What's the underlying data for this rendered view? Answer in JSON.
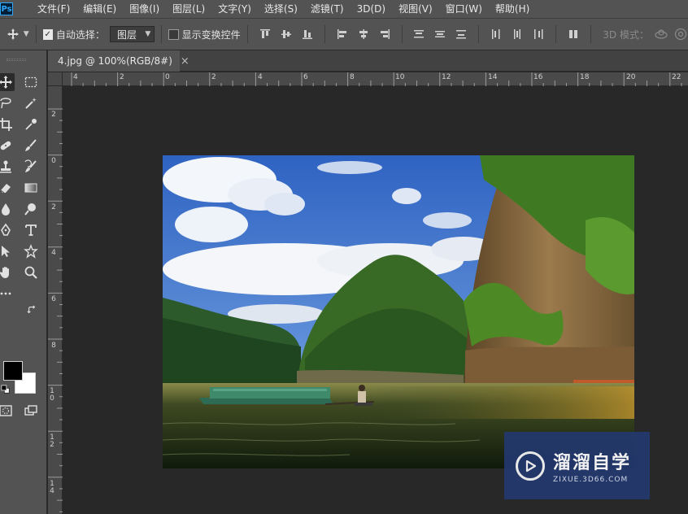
{
  "menubar": {
    "logo": "Ps",
    "items": [
      "文件(F)",
      "编辑(E)",
      "图像(I)",
      "图层(L)",
      "文字(Y)",
      "选择(S)",
      "滤镜(T)",
      "3D(D)",
      "视图(V)",
      "窗口(W)",
      "帮助(H)"
    ]
  },
  "options": {
    "auto_select_label": "自动选择：",
    "auto_select_checked": true,
    "layer_select_value": "图层",
    "show_transform_label": "显示变换控件",
    "mode_3d_label": "3D 模式："
  },
  "document": {
    "tab_title": "4.jpg @ 100%(RGB/8#)",
    "close_glyph": "×"
  },
  "rulers": {
    "h_labels": [
      "4",
      "2",
      "0",
      "2",
      "4",
      "6",
      "8",
      "10",
      "12",
      "14",
      "16",
      "18",
      "20",
      "22"
    ],
    "v_labels": [
      "2",
      "0",
      "2",
      "4",
      "6",
      "8",
      "10",
      "12",
      "14"
    ]
  },
  "icons": {
    "tools": [
      "move-icon",
      "marquee-icon",
      "lasso-icon",
      "magic-wand-icon",
      "crop-icon",
      "eyedropper-icon",
      "healing-brush-icon",
      "brush-icon",
      "clone-stamp-icon",
      "history-brush-icon",
      "eraser-icon",
      "gradient-icon",
      "blur-icon",
      "dodge-icon",
      "pen-icon",
      "type-icon",
      "path-selection-icon",
      "shape-icon",
      "hand-icon",
      "zoom-icon",
      "more-tools-icon",
      "swap-colors-icon",
      "default-colors-icon",
      "quick-mask-icon",
      "screen-mode-icon"
    ]
  },
  "colors": {
    "foreground": "#000000",
    "background": "#ffffff",
    "watermark_bg": "#23386e"
  },
  "watermark": {
    "title": "溜溜自学",
    "subtitle": "ZIXUE.3D66.COM"
  }
}
